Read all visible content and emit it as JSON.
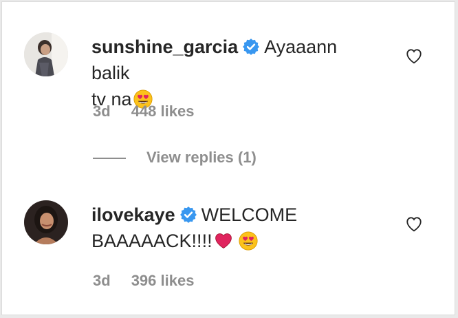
{
  "comments": [
    {
      "username": "sunshine_garcia",
      "text_line1": "Ayaaann balik",
      "text_line2": "tv na",
      "time": "3d",
      "likes": "448 likes",
      "replies_label": "View replies (1)"
    },
    {
      "username": "ilovekaye",
      "text_line1": "WELCOME",
      "text_line2": "BAAAAACK!!!!",
      "time": "3d",
      "likes": "396 likes"
    }
  ],
  "colors": {
    "verified": "#3897f0",
    "text": "#262626",
    "muted": "#8e8e8e",
    "heart_emoji": "#e0245e"
  },
  "icons": [
    "verified-badge-icon",
    "heart-eyes-emoji-icon",
    "red-heart-emoji-icon",
    "like-heart-icon"
  ]
}
